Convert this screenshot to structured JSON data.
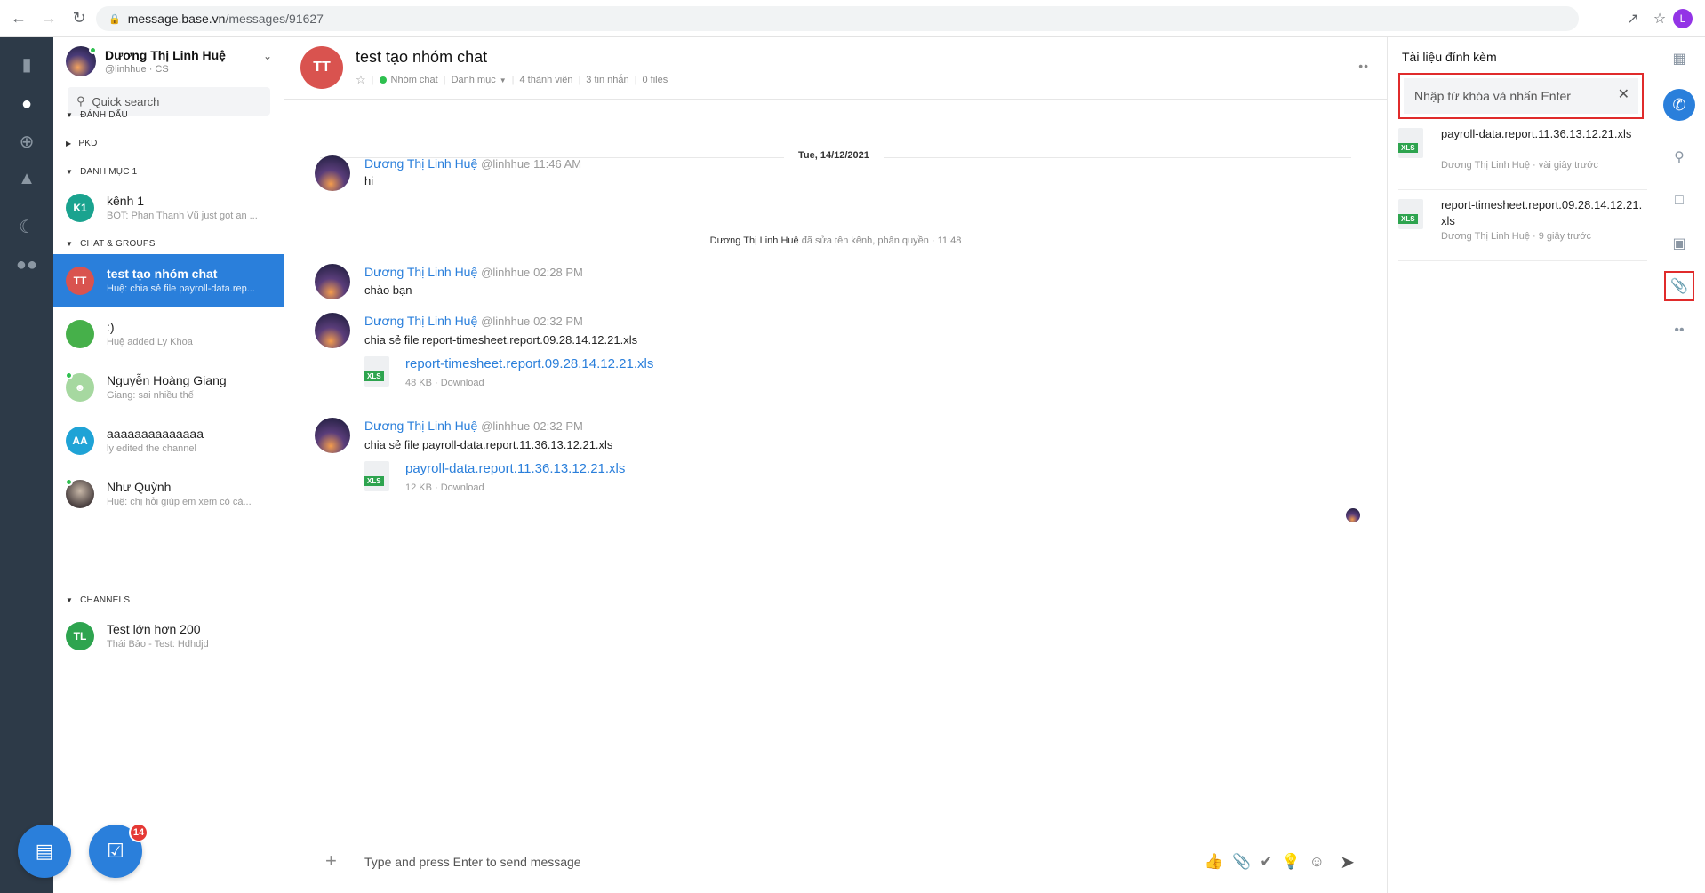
{
  "browser": {
    "url_domain": "message.base.vn",
    "url_path": "/messages/91627",
    "profile_initial": "L"
  },
  "user": {
    "name": "Dương Thị Linh Huệ",
    "handle": "@linhhue · CS"
  },
  "sidebar": {
    "search_placeholder": "Quick search",
    "sections": {
      "danh_dau": "ĐÁNH DẤU",
      "pkd": "PKD",
      "danh_muc_1": "DANH MỤC 1",
      "chat_groups": "CHAT & GROUPS",
      "channels": "CHANNELS"
    },
    "conversations": [
      {
        "initials": "K1",
        "title": "kênh 1",
        "subtitle": "BOT: Phan Thanh Vũ just got an ...",
        "color": "#1aa38f"
      },
      {
        "initials": "TT",
        "title": "test tạo nhóm chat",
        "subtitle": "Huệ: chia sẻ file payroll-data.rep...",
        "color": "#d9534f"
      },
      {
        "initials": "",
        "title": ":)",
        "subtitle": "Huệ added Ly Khoa",
        "color": "#46b04a"
      },
      {
        "initials": "",
        "title": "Nguyễn Hoàng Giang",
        "subtitle": "Giang: sai nhiều thế",
        "color": "#a6d8a0"
      },
      {
        "initials": "AA",
        "title": "aaaaaaaaaaaaaa",
        "subtitle": "ly edited the channel",
        "color": "#1fa3d6"
      },
      {
        "initials": "",
        "title": "Như Quỳnh",
        "subtitle": "Huệ: chị hỏi giúp em xem có cả...",
        "color": "#6b6b6b"
      },
      {
        "initials": "TL",
        "title": "Test lớn hơn 200",
        "subtitle": "Thái Bảo - Test: Hdhdjd",
        "color": "#2ea44f"
      }
    ],
    "task_badge": "14"
  },
  "chat": {
    "initials": "TT",
    "title": "test tạo nhóm chat",
    "type": "Nhóm chat",
    "category": "Danh mục",
    "members": "4 thành viên",
    "messages_count": "3 tin nhắn",
    "files_count": "0 files",
    "date": "Tue, 14/12/2021",
    "messages": [
      {
        "name": "Dương Thị Linh Huệ",
        "handle": "@linhhue",
        "time": "11:46 AM",
        "text": "hi"
      },
      {
        "name": "Dương Thị Linh Huệ",
        "handle": "@linhhue",
        "time": "02:28 PM",
        "text": "chào bạn"
      },
      {
        "name": "Dương Thị Linh Huệ",
        "handle": "@linhhue",
        "time": "02:32 PM",
        "text": "chia sẻ file report-timesheet.report.09.28.14.12.21.xls",
        "file": "report-timesheet.report.09.28.14.12.21.xls",
        "size": "48 KB · Download"
      },
      {
        "name": "Dương Thị Linh Huệ",
        "handle": "@linhhue",
        "time": "02:32 PM",
        "text": "chia sẻ file payroll-data.report.11.36.13.12.21.xls",
        "file": "payroll-data.report.11.36.13.12.21.xls",
        "size": "12 KB · Download"
      }
    ],
    "system_name": "Dương Thị Linh Huệ",
    "system_text": "đã sửa tên kênh, phân quyền · 11:48",
    "composer_placeholder": "Type and press Enter to send message"
  },
  "attachments": {
    "title": "Tài liệu đính kèm",
    "search_placeholder": "Nhập từ khóa và nhấn Enter",
    "items": [
      {
        "name": "payroll-data.report.11.36.13.12.21.xls",
        "meta": "Dương Thị Linh Huệ · vài giây trước"
      },
      {
        "name": "report-timesheet.report.09.28.14.12.21.xls",
        "meta": "Dương Thị Linh Huệ · 9 giây trước"
      }
    ]
  },
  "file_tag": "XLS"
}
